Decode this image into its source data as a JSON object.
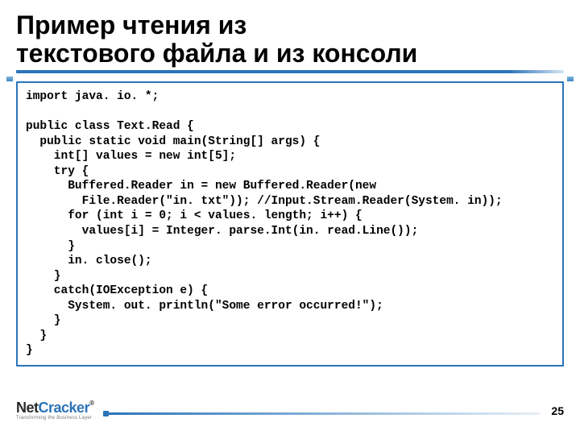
{
  "title_line1": "Пример чтения из",
  "title_line2": "текстового файла и из консоли",
  "code": "import java. io. *;\n\npublic class Text.Read {\n  public static void main(String[] args) {\n    int[] values = new int[5];\n    try {\n      Buffered.Reader in = new Buffered.Reader(new\n        File.Reader(\"in. txt\")); //Input.Stream.Reader(System. in));\n      for (int i = 0; i < values. length; i++) {\n        values[i] = Integer. parse.Int(in. read.Line());\n      }\n      in. close();\n    }\n    catch(IOException e) {\n      System. out. println(\"Some error occurred!\");\n    }\n  }\n}",
  "logo": {
    "net": "Net",
    "cracker": "Cracker",
    "tagline": "Transforming the Business Layer"
  },
  "page_number": "25"
}
